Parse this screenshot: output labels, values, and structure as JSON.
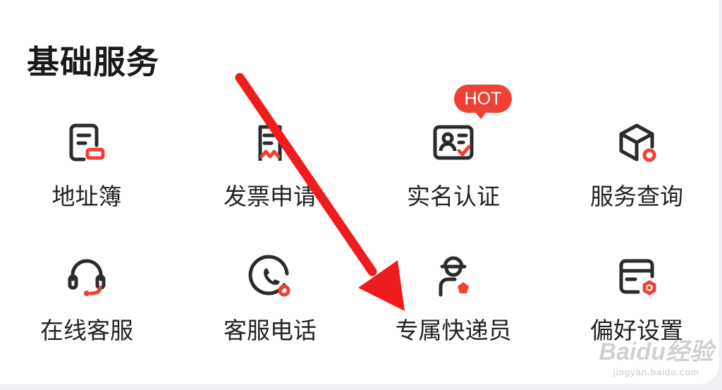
{
  "section": {
    "title": "基础服务"
  },
  "badge": "HOT",
  "items": [
    {
      "label": "地址簿",
      "icon": "address-book-icon"
    },
    {
      "label": "发票申请",
      "icon": "invoice-icon"
    },
    {
      "label": "实名认证",
      "icon": "id-verify-icon"
    },
    {
      "label": "服务查询",
      "icon": "service-query-icon"
    },
    {
      "label": "在线客服",
      "icon": "headset-icon"
    },
    {
      "label": "客服电话",
      "icon": "phone-icon"
    },
    {
      "label": "专属快递员",
      "icon": "courier-icon"
    },
    {
      "label": "偏好设置",
      "icon": "preference-icon"
    }
  ],
  "watermark": {
    "brand": "Baidu经验",
    "url": "jingyan.baidu.com"
  },
  "colors": {
    "accent": "#ef4136",
    "icon_stroke": "#2b2b2b",
    "arrow": "#ee1c1c"
  }
}
